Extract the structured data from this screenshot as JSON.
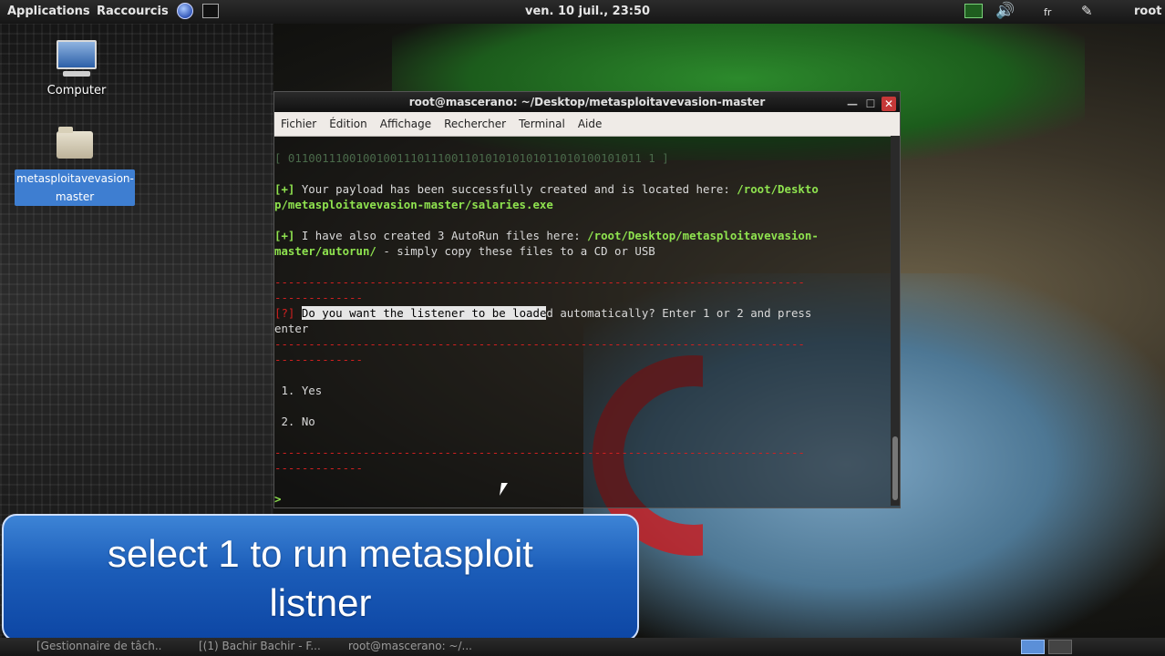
{
  "top_panel": {
    "applications": "Applications",
    "shortcuts": "Raccourcis",
    "clock": "ven. 10 juil., 23:50",
    "keyboard": "fr",
    "user": "root"
  },
  "desktop": {
    "computer_label": "Computer",
    "folder_label": "metasploitavevasion-master"
  },
  "terminal": {
    "title": "root@mascerano: ~/Desktop/metasploitavevasion-master",
    "menu": [
      "Fichier",
      "Édition",
      "Affichage",
      "Rechercher",
      "Terminal",
      "Aide"
    ],
    "lines": {
      "binary": "[ 0110011100100100111011100110101010101011010100101011 1 ]",
      "l1_tag": "[+]",
      "l1_text": " Your payload has been successfully created and is located here: ",
      "l1_path_a": "/root/Deskto",
      "l1_path_b": "p/metasploitavevasion-master/salaries.exe",
      "l2_tag": "[+]",
      "l2_text": " I have also created 3 AutoRun files here: ",
      "l2_path_a": "/root/Desktop/metasploitavevasion-",
      "l2_path_b": "master/autorun/",
      "l2_tail": " - simply copy these files to a CD or USB",
      "dash_long": "------------------------------------------------------------------------------",
      "dash_short": "-------------",
      "q_tag": "[?]",
      "q_sel": "Do you want the listener to be loade",
      "q_rest_a": "d automatically? Enter 1 or 2 and press",
      "q_rest_b": "enter",
      "opt1": " 1. Yes",
      "opt2": " 2. No",
      "prompt": ">"
    }
  },
  "caption": {
    "line1": "select 1 to run metasploit",
    "line2": "listner"
  },
  "taskbar": {
    "tasks": [
      "[Gestionnaire de tâch...",
      "[(1) Bachir Bachir - F...",
      "root@mascerano: ~/..."
    ]
  }
}
